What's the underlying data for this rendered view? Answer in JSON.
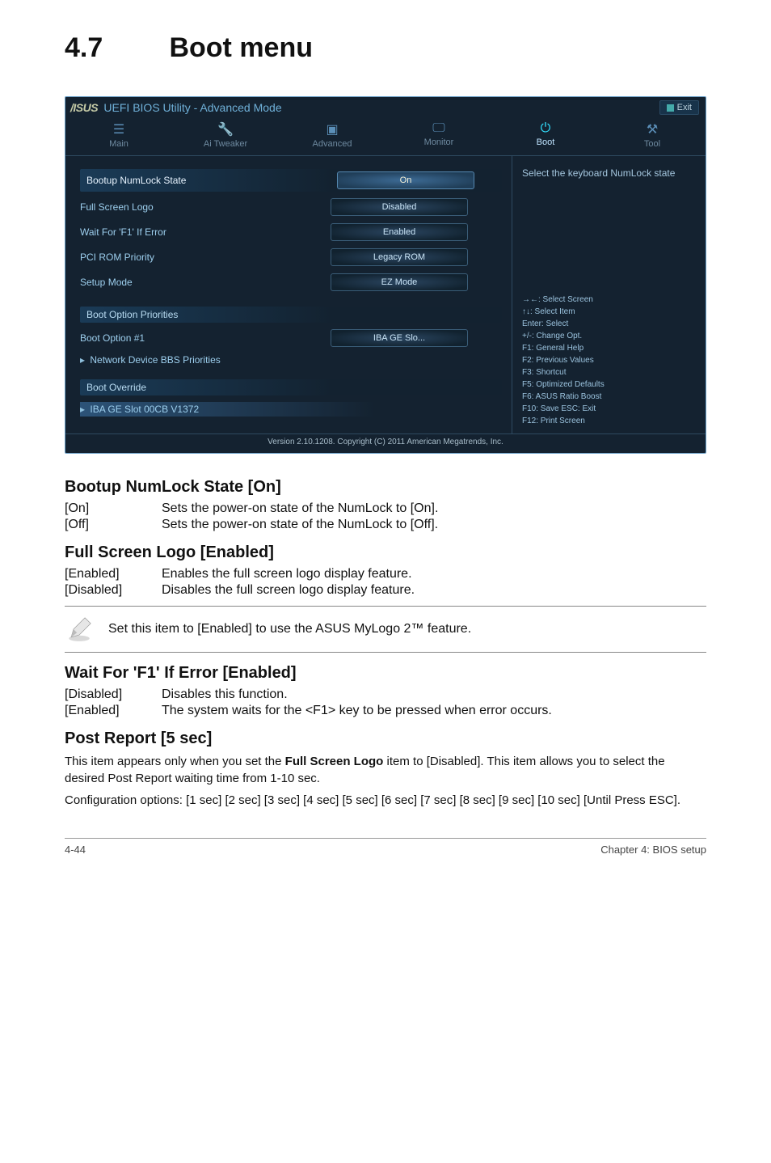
{
  "page": {
    "heading_num": "4.7",
    "heading_title": "Boot menu"
  },
  "bios": {
    "brand": "/ISUS",
    "title": "UEFI BIOS Utility - Advanced Mode",
    "exit": "Exit",
    "tabs": [
      "Main",
      "Ai Tweaker",
      "Advanced",
      "Monitor",
      "Boot",
      "Tool"
    ],
    "rows": {
      "bootup": {
        "label": "Bootup NumLock State",
        "value": "On"
      },
      "fullscreen": {
        "label": "Full Screen Logo",
        "value": "Disabled"
      },
      "waitf1": {
        "label": "Wait For 'F1' If Error",
        "value": "Enabled"
      },
      "pci": {
        "label": "PCI ROM Priority",
        "value": "Legacy ROM"
      },
      "setup": {
        "label": "Setup Mode",
        "value": "EZ Mode"
      }
    },
    "boot_priorities_hdr": "Boot Option Priorities",
    "boot_option1": {
      "label": "Boot Option #1",
      "value": "IBA GE Slo..."
    },
    "netdev": "Network Device BBS Priorities",
    "boot_override_hdr": "Boot Override",
    "iba": "IBA GE Slot 00CB V1372",
    "help_top": "Select the keyboard NumLock state",
    "hints": [
      "→←: Select Screen",
      "↑↓: Select Item",
      "Enter: Select",
      "+/-: Change Opt.",
      "F1: General Help",
      "F2: Previous Values",
      "F3: Shortcut",
      "F5: Optimized Defaults",
      "F6: ASUS Ratio Boost",
      "F10: Save   ESC: Exit",
      "F12: Print Screen"
    ],
    "copyright": "Version 2.10.1208.   Copyright (C) 2011 American Megatrends, Inc."
  },
  "doc": {
    "h_bootup": "Bootup NumLock State [On]",
    "bootup_defs": [
      {
        "key": "[On]",
        "val": "Sets the power-on state of the NumLock to [On]."
      },
      {
        "key": "[Off]",
        "val": "Sets the power-on state of the NumLock to [Off]."
      }
    ],
    "h_fullscreen": "Full Screen Logo [Enabled]",
    "fullscreen_defs": [
      {
        "key": "[Enabled]",
        "val": "Enables the full screen logo display feature."
      },
      {
        "key": "[Disabled]",
        "val": "Disables the full screen logo display feature."
      }
    ],
    "note": "Set this item to [Enabled] to use the ASUS MyLogo 2™ feature.",
    "h_wait": "Wait For 'F1' If Error [Enabled]",
    "wait_defs": [
      {
        "key": "[Disabled]",
        "val": "Disables this function."
      },
      {
        "key": "[Enabled]",
        "val": "The system waits for the <F1> key to be pressed when error occurs."
      }
    ],
    "h_post": "Post Report [5 sec]",
    "post_para_1a": "This item appears only when you set the ",
    "post_para_1b": "Full Screen Logo",
    "post_para_1c": " item to [Disabled]. This item allows you to select the desired Post Report waiting time from 1-10 sec.",
    "post_para_2": "Configuration options: [1 sec] [2 sec] [3 sec] [4 sec] [5 sec] [6 sec] [7 sec] [8 sec] [9 sec] [10 sec] [Until Press ESC]."
  },
  "footer": {
    "left": "4-44",
    "right": "Chapter 4: BIOS setup"
  }
}
